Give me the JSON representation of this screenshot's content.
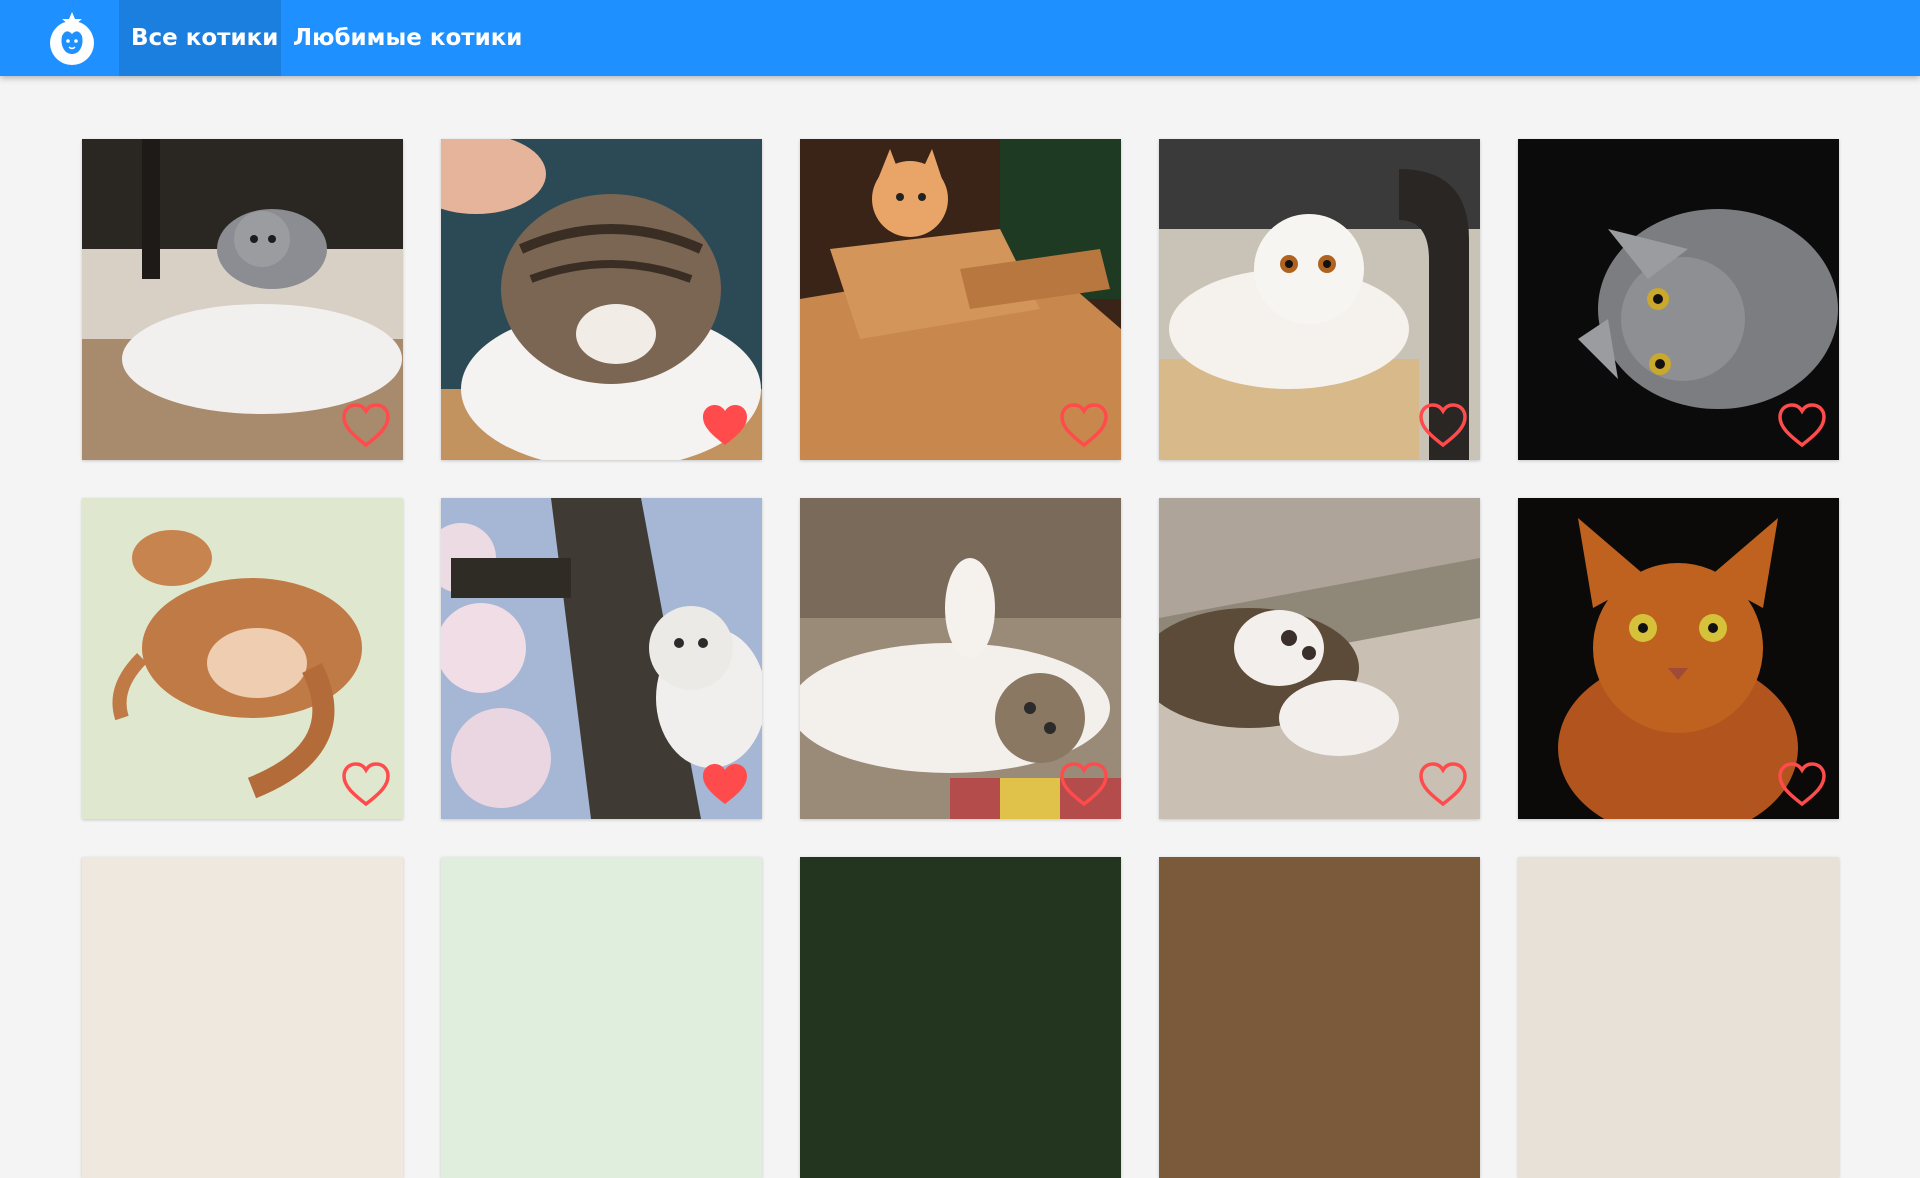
{
  "header": {
    "logo_icon": "cat-dog-logo-icon",
    "tabs": [
      {
        "label": "Все котики",
        "active": true
      },
      {
        "label": "Любимые котики",
        "active": false
      }
    ]
  },
  "colors": {
    "header": "#1e90ff",
    "header_active_tab": "#1b7fe0",
    "background": "#f4f4f4",
    "heart": "#ff4b4b"
  },
  "cats": [
    {
      "alt": "gray kitten and white kitten",
      "favorite": false
    },
    {
      "alt": "tabby scottish fold being petted",
      "favorite": true
    },
    {
      "alt": "kitten in cardboard tank",
      "favorite": false
    },
    {
      "alt": "white scottish fold on chair",
      "favorite": false
    },
    {
      "alt": "gray cat on black background",
      "favorite": false
    },
    {
      "alt": "ginger cat sleeping",
      "favorite": false
    },
    {
      "alt": "cat on blossoming tree",
      "favorite": true
    },
    {
      "alt": "fluffy cat lying on back",
      "favorite": false
    },
    {
      "alt": "cat paws on carpet",
      "favorite": false
    },
    {
      "alt": "somali cat portrait",
      "favorite": false
    },
    {
      "alt": "",
      "favorite": false
    },
    {
      "alt": "",
      "favorite": false
    },
    {
      "alt": "",
      "favorite": false
    },
    {
      "alt": "",
      "favorite": false
    },
    {
      "alt": "",
      "favorite": false
    }
  ]
}
